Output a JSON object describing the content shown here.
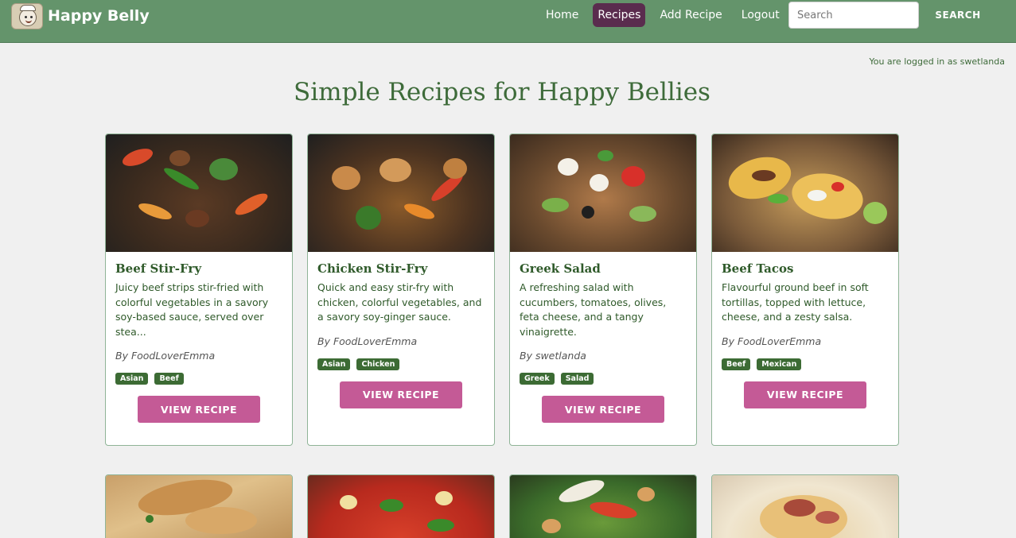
{
  "header": {
    "brand": "Happy Belly",
    "nav": [
      "Home",
      "Recipes",
      "Add Recipe",
      "Logout"
    ],
    "active_nav": "Recipes",
    "search_placeholder": "Search",
    "search_button": "SEARCH"
  },
  "login_status": "You are logged in as swetlanda",
  "page_title": "Simple Recipes for Happy Bellies",
  "colors": {
    "navbar": "#64946b",
    "active_nav": "#5a2c4e",
    "tag": "#3c6b34",
    "button": "#c45a96",
    "text_green": "#2f5a2a"
  },
  "recipes": [
    {
      "title": "Beef Stir-Fry",
      "description": "Juicy beef strips stir-fried with colorful vegetables in a savory soy-based sauce, served over stea...",
      "author": "By FoodLoverEmma",
      "tags": [
        "Asian",
        "Beef"
      ],
      "button": "VIEW RECIPE"
    },
    {
      "title": "Chicken Stir-Fry",
      "description": "Quick and easy stir-fry with chicken, colorful vegetables, and a savory soy-ginger sauce.",
      "author": "By FoodLoverEmma",
      "tags": [
        "Asian",
        "Chicken"
      ],
      "button": "VIEW RECIPE"
    },
    {
      "title": "Greek Salad",
      "description": "A refreshing salad with cucumbers, tomatoes, olives, feta cheese, and a tangy vinaigrette.",
      "author": "By swetlanda",
      "tags": [
        "Greek",
        "Salad"
      ],
      "button": "VIEW RECIPE"
    },
    {
      "title": "Beef Tacos",
      "description": "Flavourful ground beef in soft tortillas, topped with lettuce, cheese, and a zesty salsa.",
      "author": "By FoodLoverEmma",
      "tags": [
        "Beef",
        "Mexican"
      ],
      "button": "VIEW RECIPE"
    }
  ]
}
